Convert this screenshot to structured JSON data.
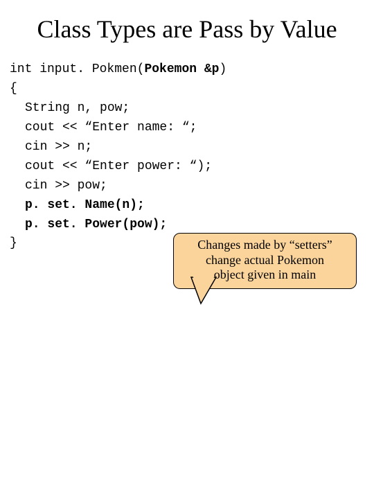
{
  "title": "Class Types are Pass by Value",
  "code": {
    "l1_a": "int input. Pokmen(",
    "l1_b": "Pokemon &p",
    "l1_c": ")",
    "l2": "{",
    "l3": "String n, pow;",
    "l4": "cout << “Enter name: “;",
    "l5": "cin >> n;",
    "l6": "cout << “Enter power: “);",
    "l7": "cin >> pow;",
    "l8": "p. set. Name(n);",
    "l9": "p. set. Power(pow);",
    "l10": "}"
  },
  "callout": {
    "line1": "Changes made by “setters”",
    "line2": "change actual Pokemon",
    "line3": "object given in main"
  }
}
